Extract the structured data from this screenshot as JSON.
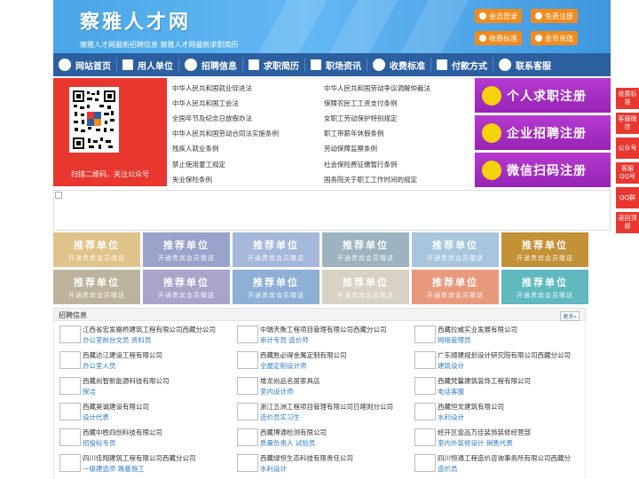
{
  "header": {
    "title": "察雅人才网",
    "subtitle": "察雅人才网最新招聘信息  察雅人才网最新求职简历",
    "buttons": [
      {
        "label": "会员登录",
        "icon": "user-icon"
      },
      {
        "label": "免费注册",
        "icon": "person-add-icon"
      },
      {
        "label": "收费标准",
        "icon": "yen-icon"
      },
      {
        "label": "金币充值",
        "icon": "coin-icon"
      }
    ]
  },
  "nav": [
    {
      "label": "网站首页",
      "icon": "home-icon"
    },
    {
      "label": "用人单位",
      "icon": "building-icon"
    },
    {
      "label": "招聘信息",
      "icon": "megaphone-icon"
    },
    {
      "label": "求职简历",
      "icon": "resume-icon"
    },
    {
      "label": "职场资讯",
      "icon": "news-icon"
    },
    {
      "label": "收费标准",
      "icon": "yen-icon"
    },
    {
      "label": "付款方式",
      "icon": "wallet-icon"
    },
    {
      "label": "联系客服",
      "icon": "phone-icon"
    }
  ],
  "qr": {
    "caption": "扫描二维码，关注公众号"
  },
  "laws": [
    "中华人民共和国就业促进法",
    "中华人民共和国劳动争议调解仲裁法",
    "中华人民共和国工会法",
    "保障农民工工资支付条例",
    "全国年节及纪念日放假办法",
    "女职工劳动保护特别规定",
    "中华人民共和国劳动合同法实施条例",
    "职工带薪年休假条例",
    "残疾人就业条例",
    "劳动保障监察条例",
    "禁止使用童工规定",
    "社会保险费征缴暂行条例",
    "失业保险条例",
    "国务院关于职工工作时间的规定"
  ],
  "register": [
    {
      "label": "个人求职注册",
      "icon": "person-icon"
    },
    {
      "label": "企业招聘注册",
      "icon": "company-icon"
    },
    {
      "label": "微信扫码注册",
      "icon": "wechat-icon"
    }
  ],
  "recommend": {
    "line1": "推荐单位",
    "line2": "开通贵宾会员赠送",
    "colors": [
      "#e0c38a",
      "#9aa3cb",
      "#a6b8d9",
      "#9db4c0",
      "#a7c6dd",
      "#c39136",
      "#bdb39c",
      "#a9a4ca",
      "#8fb0d6",
      "#d7d2c3",
      "#e99a7d",
      "#5fb9bf"
    ]
  },
  "jobs": {
    "title": "招聘信息",
    "more": "更多»",
    "items": [
      {
        "company": "江西省宏发路桥建筑工程有限公司西藏分公司",
        "positions": "办公室前台文员  资料员"
      },
      {
        "company": "中瑞天衡工程项目管理有限公司西藏分公司",
        "positions": "审计专员  造价师"
      },
      {
        "company": "西藏拉威实业发展有限公司",
        "positions": "网络管理员"
      },
      {
        "company": "西藏达江建设工程有限公司",
        "positions": "办公室人员"
      },
      {
        "company": "西藏胜必得金属定制有限公司",
        "positions": "全屋定制设计师"
      },
      {
        "company": "广东顺建规划设计研究院有限公司西藏分公司",
        "positions": "建筑设计"
      },
      {
        "company": "西藏尚智新能源科技有限公司",
        "positions": "保洁"
      },
      {
        "company": "堆龙尚品名居家具店",
        "positions": "室内设计师"
      },
      {
        "company": "西藏梵馨建筑装饰工程有限公司",
        "positions": "电话客服"
      },
      {
        "company": "西藏昊诚建设有限公司",
        "positions": "设计代表"
      },
      {
        "company": "浙江五洲工程项目管理有限公司日喀则分公司",
        "positions": "造价员实习生"
      },
      {
        "company": "西藏恒文建筑有限公司",
        "positions": "水利设计"
      },
      {
        "company": "西藏中胜四创科技有限公司",
        "positions": "招投标专员"
      },
      {
        "company": "西藏博通检测有限公司",
        "positions": "质量负责人  试验员"
      },
      {
        "company": "经开区壹品万佳装饰装修经营部",
        "positions": "室内外装修设计  销售代表"
      },
      {
        "company": "四川佳翔建筑工程有限公司西藏分公司",
        "positions": "一级建造师  路基施工"
      },
      {
        "company": "西藏绿恒生态科技有限责任公司",
        "positions": "水利设计"
      },
      {
        "company": "四川恒通工程造价咨询事务所有限公司西藏分",
        "positions": "造价员"
      }
    ]
  },
  "side": [
    {
      "label": "收费标准"
    },
    {
      "label": "客服微信"
    },
    {
      "label": "公众号"
    },
    {
      "label": "客服QQ号"
    },
    {
      "label": "QQ群"
    },
    {
      "label": "返回顶部"
    }
  ]
}
